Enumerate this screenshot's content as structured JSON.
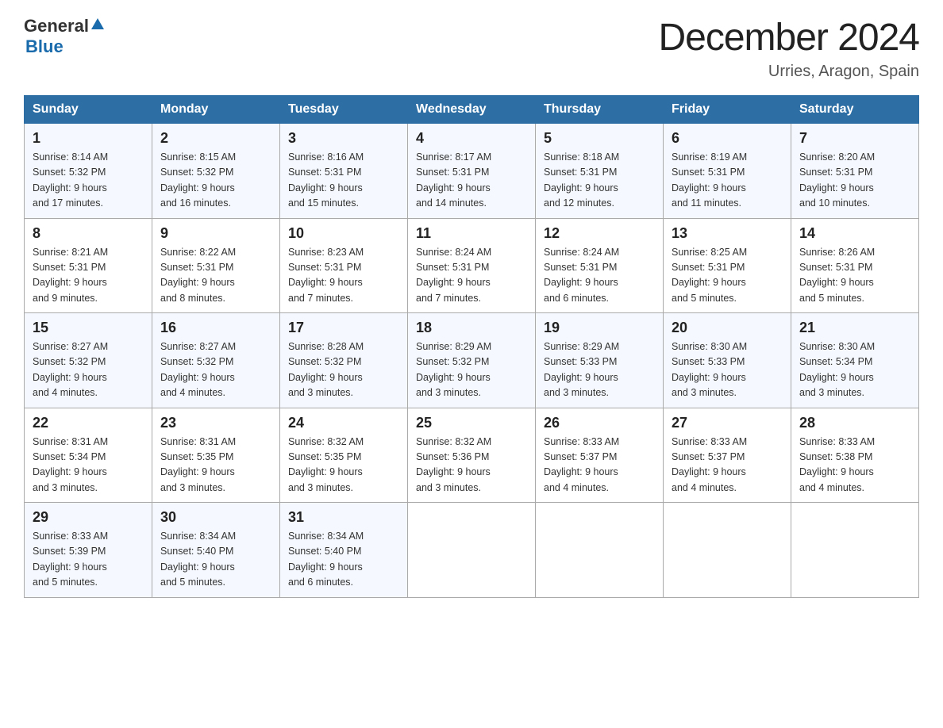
{
  "header": {
    "logo_general": "General",
    "logo_blue": "Blue",
    "title": "December 2024",
    "subtitle": "Urries, Aragon, Spain"
  },
  "days_of_week": [
    "Sunday",
    "Monday",
    "Tuesday",
    "Wednesday",
    "Thursday",
    "Friday",
    "Saturday"
  ],
  "weeks": [
    [
      {
        "day": "1",
        "sunrise": "8:14 AM",
        "sunset": "5:32 PM",
        "daylight": "9 hours and 17 minutes."
      },
      {
        "day": "2",
        "sunrise": "8:15 AM",
        "sunset": "5:32 PM",
        "daylight": "9 hours and 16 minutes."
      },
      {
        "day": "3",
        "sunrise": "8:16 AM",
        "sunset": "5:31 PM",
        "daylight": "9 hours and 15 minutes."
      },
      {
        "day": "4",
        "sunrise": "8:17 AM",
        "sunset": "5:31 PM",
        "daylight": "9 hours and 14 minutes."
      },
      {
        "day": "5",
        "sunrise": "8:18 AM",
        "sunset": "5:31 PM",
        "daylight": "9 hours and 12 minutes."
      },
      {
        "day": "6",
        "sunrise": "8:19 AM",
        "sunset": "5:31 PM",
        "daylight": "9 hours and 11 minutes."
      },
      {
        "day": "7",
        "sunrise": "8:20 AM",
        "sunset": "5:31 PM",
        "daylight": "9 hours and 10 minutes."
      }
    ],
    [
      {
        "day": "8",
        "sunrise": "8:21 AM",
        "sunset": "5:31 PM",
        "daylight": "9 hours and 9 minutes."
      },
      {
        "day": "9",
        "sunrise": "8:22 AM",
        "sunset": "5:31 PM",
        "daylight": "9 hours and 8 minutes."
      },
      {
        "day": "10",
        "sunrise": "8:23 AM",
        "sunset": "5:31 PM",
        "daylight": "9 hours and 7 minutes."
      },
      {
        "day": "11",
        "sunrise": "8:24 AM",
        "sunset": "5:31 PM",
        "daylight": "9 hours and 7 minutes."
      },
      {
        "day": "12",
        "sunrise": "8:24 AM",
        "sunset": "5:31 PM",
        "daylight": "9 hours and 6 minutes."
      },
      {
        "day": "13",
        "sunrise": "8:25 AM",
        "sunset": "5:31 PM",
        "daylight": "9 hours and 5 minutes."
      },
      {
        "day": "14",
        "sunrise": "8:26 AM",
        "sunset": "5:31 PM",
        "daylight": "9 hours and 5 minutes."
      }
    ],
    [
      {
        "day": "15",
        "sunrise": "8:27 AM",
        "sunset": "5:32 PM",
        "daylight": "9 hours and 4 minutes."
      },
      {
        "day": "16",
        "sunrise": "8:27 AM",
        "sunset": "5:32 PM",
        "daylight": "9 hours and 4 minutes."
      },
      {
        "day": "17",
        "sunrise": "8:28 AM",
        "sunset": "5:32 PM",
        "daylight": "9 hours and 3 minutes."
      },
      {
        "day": "18",
        "sunrise": "8:29 AM",
        "sunset": "5:32 PM",
        "daylight": "9 hours and 3 minutes."
      },
      {
        "day": "19",
        "sunrise": "8:29 AM",
        "sunset": "5:33 PM",
        "daylight": "9 hours and 3 minutes."
      },
      {
        "day": "20",
        "sunrise": "8:30 AM",
        "sunset": "5:33 PM",
        "daylight": "9 hours and 3 minutes."
      },
      {
        "day": "21",
        "sunrise": "8:30 AM",
        "sunset": "5:34 PM",
        "daylight": "9 hours and 3 minutes."
      }
    ],
    [
      {
        "day": "22",
        "sunrise": "8:31 AM",
        "sunset": "5:34 PM",
        "daylight": "9 hours and 3 minutes."
      },
      {
        "day": "23",
        "sunrise": "8:31 AM",
        "sunset": "5:35 PM",
        "daylight": "9 hours and 3 minutes."
      },
      {
        "day": "24",
        "sunrise": "8:32 AM",
        "sunset": "5:35 PM",
        "daylight": "9 hours and 3 minutes."
      },
      {
        "day": "25",
        "sunrise": "8:32 AM",
        "sunset": "5:36 PM",
        "daylight": "9 hours and 3 minutes."
      },
      {
        "day": "26",
        "sunrise": "8:33 AM",
        "sunset": "5:37 PM",
        "daylight": "9 hours and 4 minutes."
      },
      {
        "day": "27",
        "sunrise": "8:33 AM",
        "sunset": "5:37 PM",
        "daylight": "9 hours and 4 minutes."
      },
      {
        "day": "28",
        "sunrise": "8:33 AM",
        "sunset": "5:38 PM",
        "daylight": "9 hours and 4 minutes."
      }
    ],
    [
      {
        "day": "29",
        "sunrise": "8:33 AM",
        "sunset": "5:39 PM",
        "daylight": "9 hours and 5 minutes."
      },
      {
        "day": "30",
        "sunrise": "8:34 AM",
        "sunset": "5:40 PM",
        "daylight": "9 hours and 5 minutes."
      },
      {
        "day": "31",
        "sunrise": "8:34 AM",
        "sunset": "5:40 PM",
        "daylight": "9 hours and 6 minutes."
      },
      null,
      null,
      null,
      null
    ]
  ],
  "labels": {
    "sunrise": "Sunrise:",
    "sunset": "Sunset:",
    "daylight": "Daylight:"
  }
}
